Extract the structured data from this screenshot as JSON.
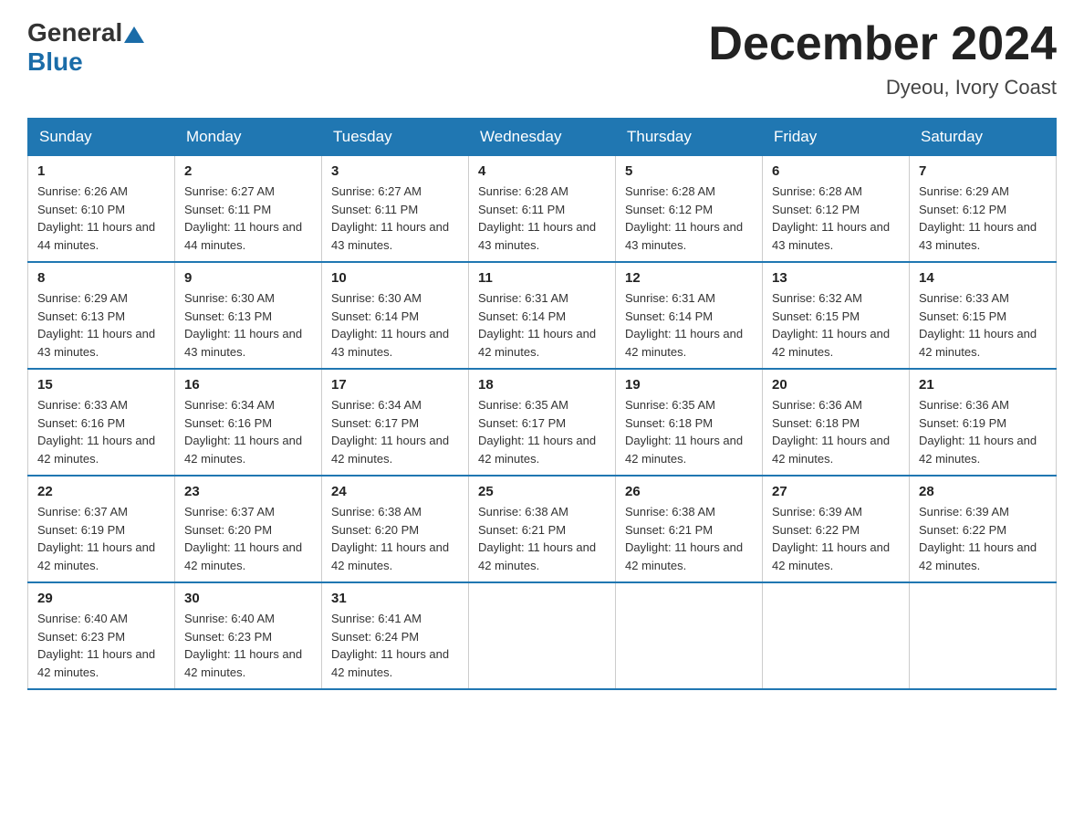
{
  "header": {
    "logo_general": "General",
    "logo_blue": "Blue",
    "title": "December 2024",
    "subtitle": "Dyeou, Ivory Coast"
  },
  "days_of_week": [
    "Sunday",
    "Monday",
    "Tuesday",
    "Wednesday",
    "Thursday",
    "Friday",
    "Saturday"
  ],
  "weeks": [
    [
      {
        "day": "1",
        "sunrise": "6:26 AM",
        "sunset": "6:10 PM",
        "daylight": "11 hours and 44 minutes."
      },
      {
        "day": "2",
        "sunrise": "6:27 AM",
        "sunset": "6:11 PM",
        "daylight": "11 hours and 44 minutes."
      },
      {
        "day": "3",
        "sunrise": "6:27 AM",
        "sunset": "6:11 PM",
        "daylight": "11 hours and 43 minutes."
      },
      {
        "day": "4",
        "sunrise": "6:28 AM",
        "sunset": "6:11 PM",
        "daylight": "11 hours and 43 minutes."
      },
      {
        "day": "5",
        "sunrise": "6:28 AM",
        "sunset": "6:12 PM",
        "daylight": "11 hours and 43 minutes."
      },
      {
        "day": "6",
        "sunrise": "6:28 AM",
        "sunset": "6:12 PM",
        "daylight": "11 hours and 43 minutes."
      },
      {
        "day": "7",
        "sunrise": "6:29 AM",
        "sunset": "6:12 PM",
        "daylight": "11 hours and 43 minutes."
      }
    ],
    [
      {
        "day": "8",
        "sunrise": "6:29 AM",
        "sunset": "6:13 PM",
        "daylight": "11 hours and 43 minutes."
      },
      {
        "day": "9",
        "sunrise": "6:30 AM",
        "sunset": "6:13 PM",
        "daylight": "11 hours and 43 minutes."
      },
      {
        "day": "10",
        "sunrise": "6:30 AM",
        "sunset": "6:14 PM",
        "daylight": "11 hours and 43 minutes."
      },
      {
        "day": "11",
        "sunrise": "6:31 AM",
        "sunset": "6:14 PM",
        "daylight": "11 hours and 42 minutes."
      },
      {
        "day": "12",
        "sunrise": "6:31 AM",
        "sunset": "6:14 PM",
        "daylight": "11 hours and 42 minutes."
      },
      {
        "day": "13",
        "sunrise": "6:32 AM",
        "sunset": "6:15 PM",
        "daylight": "11 hours and 42 minutes."
      },
      {
        "day": "14",
        "sunrise": "6:33 AM",
        "sunset": "6:15 PM",
        "daylight": "11 hours and 42 minutes."
      }
    ],
    [
      {
        "day": "15",
        "sunrise": "6:33 AM",
        "sunset": "6:16 PM",
        "daylight": "11 hours and 42 minutes."
      },
      {
        "day": "16",
        "sunrise": "6:34 AM",
        "sunset": "6:16 PM",
        "daylight": "11 hours and 42 minutes."
      },
      {
        "day": "17",
        "sunrise": "6:34 AM",
        "sunset": "6:17 PM",
        "daylight": "11 hours and 42 minutes."
      },
      {
        "day": "18",
        "sunrise": "6:35 AM",
        "sunset": "6:17 PM",
        "daylight": "11 hours and 42 minutes."
      },
      {
        "day": "19",
        "sunrise": "6:35 AM",
        "sunset": "6:18 PM",
        "daylight": "11 hours and 42 minutes."
      },
      {
        "day": "20",
        "sunrise": "6:36 AM",
        "sunset": "6:18 PM",
        "daylight": "11 hours and 42 minutes."
      },
      {
        "day": "21",
        "sunrise": "6:36 AM",
        "sunset": "6:19 PM",
        "daylight": "11 hours and 42 minutes."
      }
    ],
    [
      {
        "day": "22",
        "sunrise": "6:37 AM",
        "sunset": "6:19 PM",
        "daylight": "11 hours and 42 minutes."
      },
      {
        "day": "23",
        "sunrise": "6:37 AM",
        "sunset": "6:20 PM",
        "daylight": "11 hours and 42 minutes."
      },
      {
        "day": "24",
        "sunrise": "6:38 AM",
        "sunset": "6:20 PM",
        "daylight": "11 hours and 42 minutes."
      },
      {
        "day": "25",
        "sunrise": "6:38 AM",
        "sunset": "6:21 PM",
        "daylight": "11 hours and 42 minutes."
      },
      {
        "day": "26",
        "sunrise": "6:38 AM",
        "sunset": "6:21 PM",
        "daylight": "11 hours and 42 minutes."
      },
      {
        "day": "27",
        "sunrise": "6:39 AM",
        "sunset": "6:22 PM",
        "daylight": "11 hours and 42 minutes."
      },
      {
        "day": "28",
        "sunrise": "6:39 AM",
        "sunset": "6:22 PM",
        "daylight": "11 hours and 42 minutes."
      }
    ],
    [
      {
        "day": "29",
        "sunrise": "6:40 AM",
        "sunset": "6:23 PM",
        "daylight": "11 hours and 42 minutes."
      },
      {
        "day": "30",
        "sunrise": "6:40 AM",
        "sunset": "6:23 PM",
        "daylight": "11 hours and 42 minutes."
      },
      {
        "day": "31",
        "sunrise": "6:41 AM",
        "sunset": "6:24 PM",
        "daylight": "11 hours and 42 minutes."
      },
      null,
      null,
      null,
      null
    ]
  ]
}
